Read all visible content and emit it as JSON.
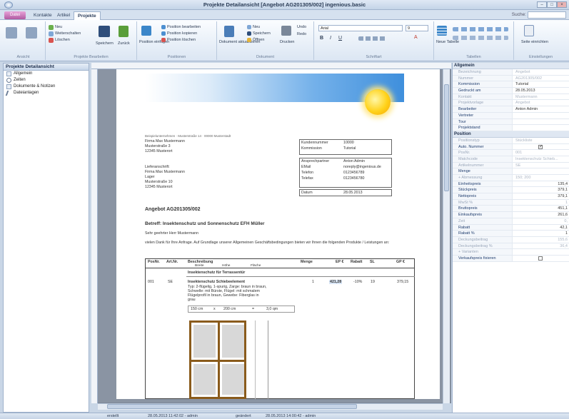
{
  "window": {
    "title": "Projekte Detailansicht [Angebot AG201305/002]  ingenious.basic",
    "min_label": "–",
    "max_label": "□",
    "close_label": "×"
  },
  "tabs": {
    "file": "Datei",
    "items": [
      "Kontakte",
      "Artikel",
      "Projekte"
    ],
    "search_label": "Suche:"
  },
  "ribbon": {
    "new": "Neu",
    "duplicate": "Weiterschalten",
    "delete": "Löschen",
    "save": "Speichern",
    "back": "Zurück",
    "position_insert": "Position einfügen",
    "pos_edit": "Position bearbeiten",
    "pos_copy": "Position kopieren",
    "pos_delete": "Position löschen",
    "doc_refresh": "Dokument aktualisieren",
    "doc_new": "Neu",
    "doc_save": "Speichern",
    "doc_open": "Öffnen",
    "print": "Drucken",
    "undo": "Undo",
    "redo": "Redo",
    "font_name": "Arial",
    "font_size": "9",
    "new_table": "Neue Tabelle",
    "page_setup": "Seite einrichten",
    "groups": [
      "Ansicht",
      "Projekte Bearbeiten",
      "Positionen",
      "Dokument",
      "Schriftart",
      "Tabellen",
      "Einstellungen"
    ]
  },
  "left_panel": {
    "header": "Projekte Detailansicht",
    "items": [
      "Allgemein",
      "Zeiten",
      "Dokumente & Notizen",
      "Dateianlagen"
    ]
  },
  "document": {
    "sender_line": "Beispielunternehmen · Musterstraße 14 · 00000 Musterstadt",
    "recipient": [
      "Firma Max Mustermann",
      "Musterstraße 3",
      "12345 Musterort"
    ],
    "delivery_label": "Lieferanschrift:",
    "delivery": [
      "Firma Max Mustermann",
      "Lager",
      "Musterstraße 10",
      "12345 Musterort"
    ],
    "info_rows": [
      [
        "Kundennummer",
        "10000"
      ],
      [
        "Kommission",
        "Tutorial"
      ],
      [
        "Ansprechpartner",
        "Anton Admin"
      ],
      [
        "EMail",
        "noreply@ingenious.de"
      ],
      [
        "Telefon",
        "0123456789"
      ],
      [
        "Telefax",
        "0123456780"
      ],
      [
        "Datum",
        "28.05.2013"
      ]
    ],
    "heading": "Angebot AG201305/002",
    "subject": "Betreff: Insektenschutz und Sonnenschutz EFH Müller",
    "greeting": "Sehr geehrter Herr Mustermann",
    "intro": "vielen Dank für Ihre Anfrage. Auf Grundlage unserer Allgemeinen Geschäftsbedingungen bieten wir Ihnen die folgenden Produkte / Leistungen an:",
    "table_headers": [
      "PosNr.",
      "Art.Nr.",
      "Beschreibung",
      "Menge",
      "EP €",
      "Rabatt",
      "SL",
      "GP €"
    ],
    "table_subheaders": [
      "Breite",
      "Höhe",
      "Fläche"
    ],
    "section_title": "Insektenschutz für Terrassentür",
    "row": {
      "pos": "001",
      "art": "SE",
      "title": "Insektenschutz Schiebeelement",
      "desc": [
        "Typ: 2-flügelig, 1-spurig, Zarge: braun in braun,",
        "Schwelle: mit Bürste, Flügel: mit schmalem",
        "Flügelprofil in braun, Gewebe: Fiberglas in",
        "grau"
      ],
      "qty": "1",
      "ep": "421,28",
      "discount": "-10%",
      "sl": "19",
      "gp": "379,15"
    },
    "dims": [
      "150 cm",
      "x",
      "200 cm",
      "=",
      "3,0 qm"
    ]
  },
  "props": {
    "cat_general": "Allgemein",
    "general": [
      [
        "Bezeichnung",
        "Angebot",
        true
      ],
      [
        "Nummer",
        "AG201305/002",
        true
      ],
      [
        "Kommission",
        "Tutorial",
        false
      ],
      [
        "Gedruckt am",
        "28.05.2013",
        false
      ],
      [
        "Kontakt",
        "Mustermann",
        true
      ],
      [
        "Projektvorlage",
        "Angebot",
        true
      ],
      [
        "Bearbeiter",
        "Anton Admin",
        false
      ],
      [
        "Vertreter",
        "",
        false
      ],
      [
        "Tour",
        "",
        false
      ],
      [
        "Projektstand",
        "",
        false
      ]
    ],
    "cat_position": "Position",
    "position": [
      [
        "Positionstyp",
        "Stückliste",
        true,
        "l"
      ],
      [
        "Auto. Nummer",
        "✓",
        false,
        "cb"
      ],
      [
        "PosNr.",
        "001",
        true,
        "l"
      ],
      [
        "Matchcode",
        "Insektenschutz Schieb...",
        true,
        "l"
      ],
      [
        "Artikelnummer",
        "SE",
        true,
        "l"
      ],
      [
        "Menge",
        "",
        false,
        "l"
      ],
      [
        "+ Abmessung",
        "150; 200",
        true,
        "l"
      ],
      [
        "Einheitspreis",
        "135,4",
        false,
        "r"
      ],
      [
        "Stückpreis",
        "379,1",
        false,
        "r"
      ],
      [
        "Nettopreis",
        "379,1",
        false,
        "r"
      ],
      [
        "MwSt %",
        "1",
        true,
        "r"
      ],
      [
        "Bruttopreis",
        "451,1",
        false,
        "r"
      ],
      [
        "Einkaufspreis",
        "261,6",
        false,
        "r"
      ],
      [
        "Zeit",
        "0,",
        true,
        "r"
      ],
      [
        "Rabatt",
        "42,1",
        false,
        "r"
      ],
      [
        "Rabatt %",
        "1",
        false,
        "r"
      ],
      [
        "Deckungsbeitrag",
        "155,6",
        true,
        "r"
      ],
      [
        "Deckungsbeitrag %",
        "36,4",
        true,
        "r"
      ],
      [
        "+ Varianten",
        "",
        true,
        "l"
      ],
      [
        "Verkaufspreis fixieren",
        "",
        false,
        "cb0"
      ]
    ]
  },
  "status": {
    "created_label": "erstellt",
    "created_value": "28.05.2013 11:42:02 - admin",
    "changed_label": "geändert",
    "changed_value": "28.05.2013 14:00:42 - admin"
  }
}
